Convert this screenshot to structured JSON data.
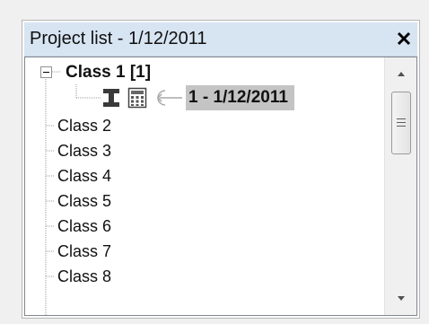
{
  "window": {
    "title": "Project list - 1/12/2011",
    "close_glyph": "×"
  },
  "tree": {
    "root": {
      "label": "Class 1 [1]",
      "expanded": true,
      "children": [
        {
          "label": "1 - 1/12/2011",
          "selected": true,
          "icons": [
            "i-beam-icon",
            "calculator-icon",
            "arrow-link-icon"
          ]
        }
      ]
    },
    "classes": [
      {
        "label": "Class 2"
      },
      {
        "label": "Class 3"
      },
      {
        "label": "Class 4"
      },
      {
        "label": "Class 5"
      },
      {
        "label": "Class 6"
      },
      {
        "label": "Class 7"
      },
      {
        "label": "Class 8"
      }
    ]
  },
  "colors": {
    "title_bar": "#d7e4f2",
    "selection": "#c4c4c4",
    "tree_line": "#9c9c9c"
  }
}
